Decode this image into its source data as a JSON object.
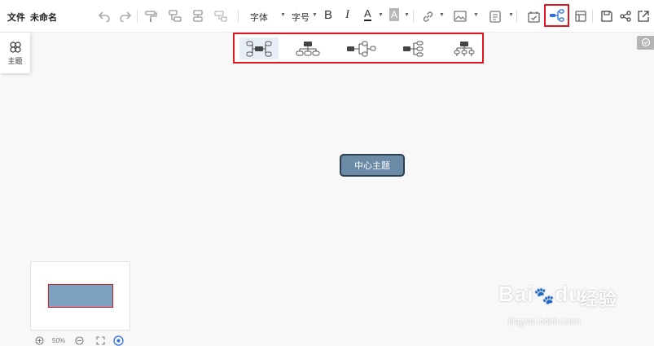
{
  "menu": {
    "file_label": "文件",
    "doc_title": "未命名"
  },
  "toolbar": {
    "font_label": "字体",
    "font_size_label": "字号",
    "bold_label": "B",
    "italic_label": "I",
    "font_color_letter": "A",
    "highlight_letter": "A",
    "icons": [
      "undo-icon",
      "redo-icon",
      "format-painter-icon",
      "insert-sibling-icon",
      "insert-child-icon",
      "insert-parent-icon",
      "link-icon",
      "image-icon",
      "note-icon",
      "task-icon",
      "structure-icon",
      "outline-icon",
      "save-icon",
      "share-icon",
      "export-icon"
    ]
  },
  "structure_bar": {
    "options": [
      {
        "name": "mind-map",
        "selected": true
      },
      {
        "name": "org-chart-down",
        "selected": false
      },
      {
        "name": "tree-both",
        "selected": false
      },
      {
        "name": "logic-right",
        "selected": false
      },
      {
        "name": "org-chart-alt",
        "selected": false
      }
    ]
  },
  "side_panel": {
    "theme_label": "主题",
    "icon": "clover-icon"
  },
  "canvas": {
    "central_topic": "中心主题"
  },
  "zoom": {
    "value_text": "50%"
  },
  "watermark": {
    "logo_text": "Bai",
    "logo_text2": "du",
    "cn_text": "经验",
    "url": "jingyan.baidu.com"
  },
  "colors": {
    "accent": "#e0141e",
    "topic_fill": "#6a8aa5",
    "topic_border": "#2d3e4c",
    "icon_blue": "#2f6fe0"
  }
}
